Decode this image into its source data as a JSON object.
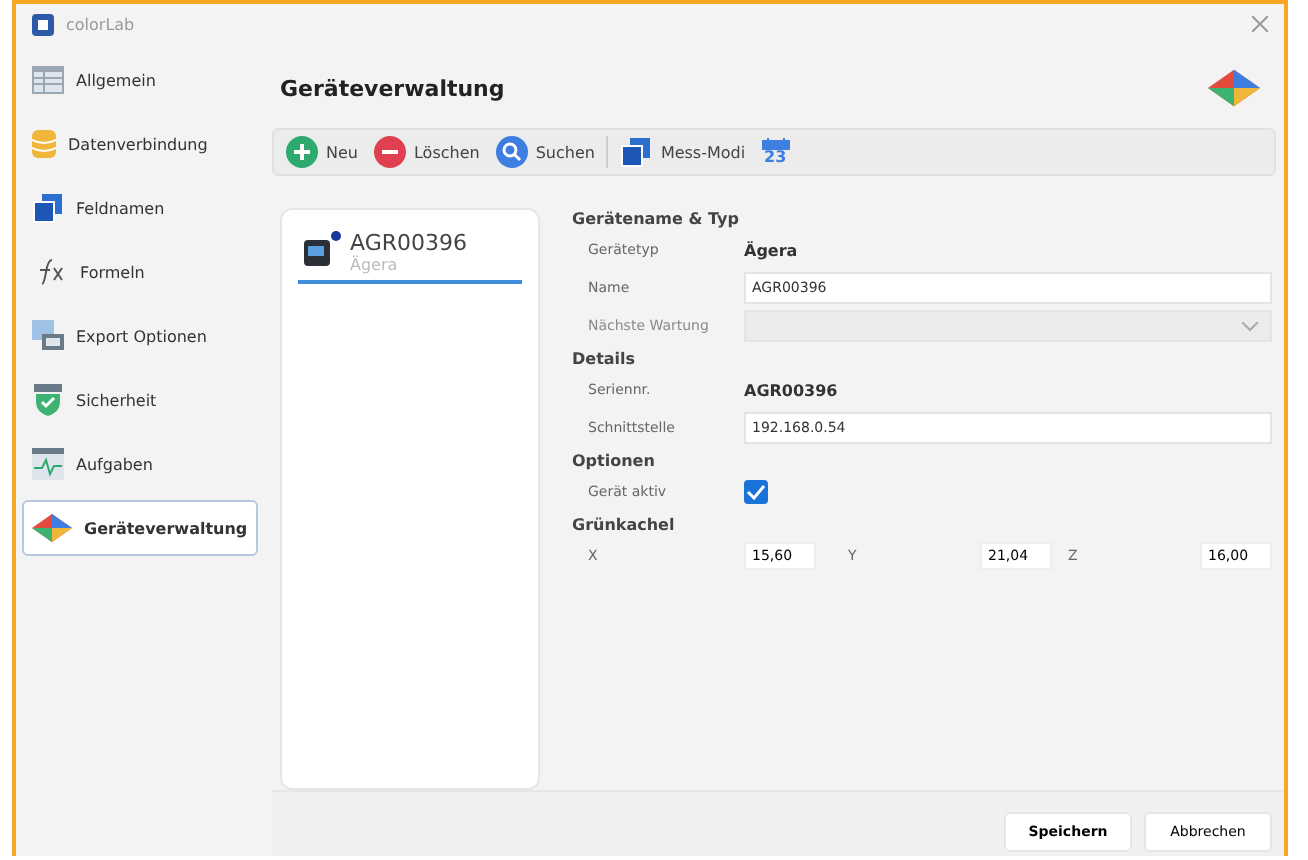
{
  "window": {
    "title": "colorLab"
  },
  "sidebar": {
    "items": [
      {
        "label": "Allgemein",
        "selected": false
      },
      {
        "label": "Datenverbindung",
        "selected": false
      },
      {
        "label": "Feldnamen",
        "selected": false
      },
      {
        "label": "Formeln",
        "selected": false
      },
      {
        "label": "Export Optionen",
        "selected": false
      },
      {
        "label": "Sicherheit",
        "selected": false
      },
      {
        "label": "Aufgaben",
        "selected": false
      },
      {
        "label": "Geräteverwaltung",
        "selected": true
      }
    ]
  },
  "page_title": "Geräteverwaltung",
  "toolbar": [
    {
      "kind": "button",
      "label": "Neu"
    },
    {
      "kind": "button",
      "label": "Löschen"
    },
    {
      "kind": "button",
      "label": "Suchen"
    },
    {
      "kind": "button",
      "label": "Mess-Modi"
    },
    {
      "kind": "date",
      "label": "23"
    }
  ],
  "devices": [
    {
      "name": "AGR00396",
      "type": "Ägera",
      "selected": true
    }
  ],
  "sections": [
    {
      "title": "Gerätename & Typ",
      "rows": [
        {
          "kind": "text",
          "label": "Gerätetyp",
          "value": "Ägera"
        },
        {
          "kind": "input",
          "label": "Name",
          "value": "AGR00396"
        },
        {
          "kind": "select",
          "label": "Nächste Wartung",
          "disabled": true
        }
      ]
    },
    {
      "title": "Details",
      "rows": [
        {
          "kind": "text",
          "label": "Seriennr.",
          "value": "AGR00396"
        },
        {
          "kind": "input",
          "label": "Schnittstelle",
          "value": "192.168.0.54"
        }
      ]
    },
    {
      "title": "Optionen",
      "rows": [
        {
          "kind": "check",
          "label": "Gerät aktiv",
          "checked": true
        }
      ]
    },
    {
      "title": "Grünkachel",
      "rows": [
        {
          "kind": "xyz",
          "fields": [
            {
              "label": "X",
              "value": "15,60"
            },
            {
              "label": "Y",
              "value": "21,04"
            },
            {
              "label": "Z",
              "value": "16,00"
            }
          ]
        }
      ]
    }
  ],
  "buttons": [
    "Speichern",
    "Abbrechen"
  ]
}
